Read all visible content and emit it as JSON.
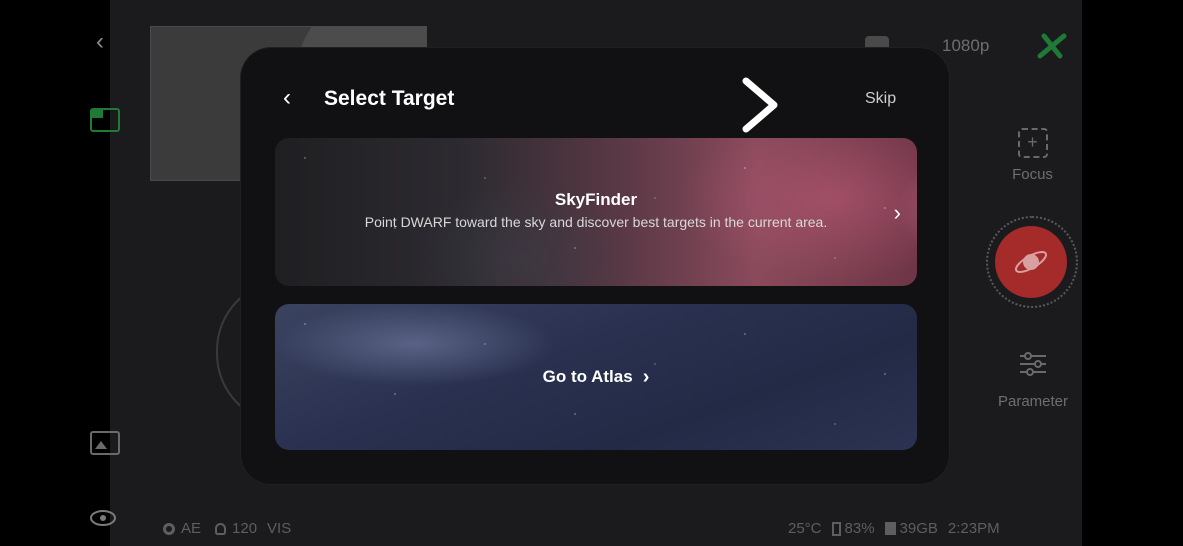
{
  "header": {
    "resolution": "1080p"
  },
  "right_rail": {
    "focus_label": "Focus",
    "parameter_label": "Parameter"
  },
  "modal": {
    "title": "Select Target",
    "skip_label": "Skip",
    "skyfinder": {
      "title": "SkyFinder",
      "description": "Point DWARF toward the sky and discover best targets in the current area."
    },
    "atlas": {
      "label": "Go to Atlas"
    }
  },
  "status_bar": {
    "ae": "AE",
    "ir": "120",
    "mode": "VIS",
    "temperature": "25°C",
    "battery": "83%",
    "storage": "39GB",
    "time": "2:23PM"
  },
  "colors": {
    "accent_green": "#1e7a36",
    "shutter_red": "#a52a2a",
    "modal_bg": "#111113"
  },
  "icons": [
    "back-icon",
    "layout-icon",
    "gallery-icon",
    "eye-icon",
    "camera-icon",
    "connection-icon",
    "focus-icon",
    "shutter-icon",
    "parameter-icon",
    "chevron-right-icon"
  ]
}
